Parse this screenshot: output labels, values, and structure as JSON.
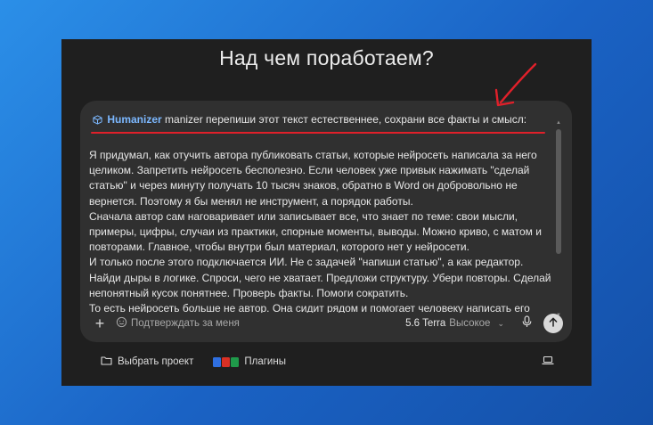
{
  "page": {
    "title": "Над чем поработаем?"
  },
  "composer": {
    "plugin_tag": "Humanizer",
    "prompt": "manizer перепиши этот текст естественнее, сохрани все факты и смысл:",
    "paragraphs": [
      "Я придумал, как отучить автора публиковать статьи, которые нейросеть написала за него целиком. Запретить нейросеть бесполезно. Если человек уже привык нажимать \"сделай статью\" и через минуту получать 10 тысяч знаков, обратно в Word он добровольно не вернется. Поэтому я бы менял не инструмент, а порядок работы.",
      "Сначала автор сам наговаривает или записывает все, что знает по теме: свои мысли, примеры, цифры, случаи из практики, спорные моменты, выводы. Можно криво, с матом и повторами. Главное, чтобы внутри был материал, которого нет у нейросети.",
      "И только после этого подключается ИИ. Не с задачей \"напиши статью\", а как редактор. Найди дыры в логике. Спроси, чего не хватает. Предложи структуру. Убери повторы. Сделай непонятный кусок понятнее. Проверь факты. Помоги сократить.",
      "То есть нейросеть больше не автор. Она сидит рядом и помогает человеку написать его"
    ]
  },
  "toolbar": {
    "add_label": "+",
    "think_label": "Подтверждать за меня",
    "model_name": "5.6 Terra",
    "model_level": "Высокое"
  },
  "bottom_bar": {
    "project_label": "Выбрать проект",
    "plugins_label": "Плагины"
  },
  "colors": {
    "accent_link": "#7cb8ff",
    "annotation_red": "#e0202a",
    "background_blue": "#1a62c4",
    "window_bg": "#1f1f1f",
    "composer_bg": "#303030"
  },
  "icons": {
    "plugin_tag": "cube-icon",
    "think": "smile-icon",
    "model_dropdown": "chevron-down-icon",
    "mic": "microphone-icon",
    "send": "arrow-up-icon",
    "project": "folder-icon",
    "plugins": "app-icons",
    "laptop": "laptop-icon"
  }
}
